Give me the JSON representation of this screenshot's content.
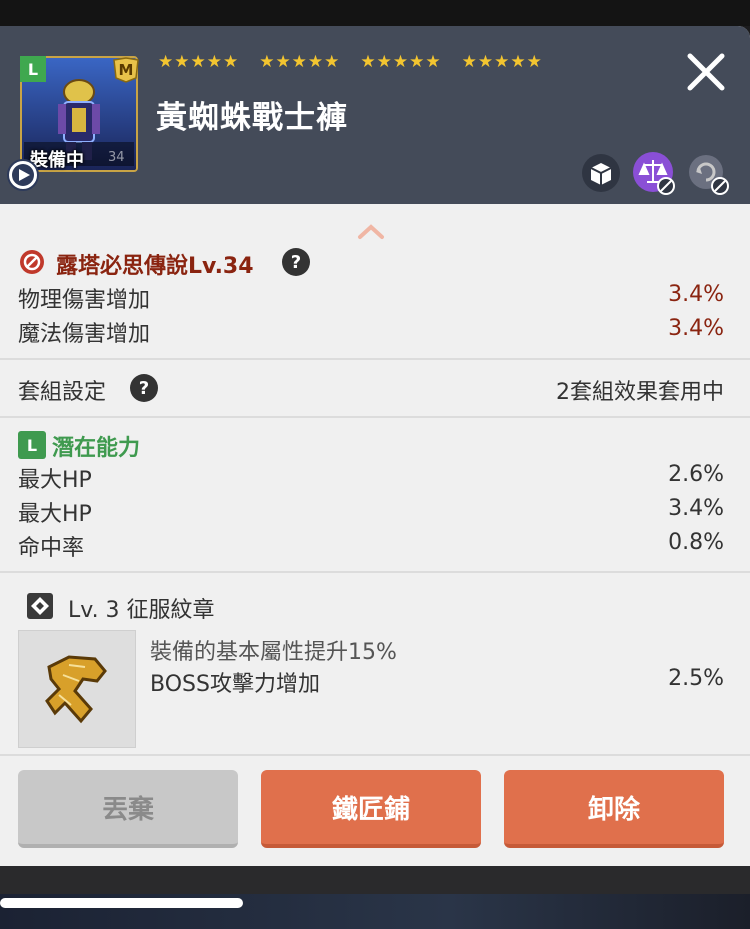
{
  "header": {
    "item_name": "黃蜘蛛戰士褲",
    "equipped_label": "裝備中",
    "item_level_small": "34",
    "grade_badge": "L",
    "rank_badge": "M",
    "stars": [
      "★★★★★",
      "★★★★★",
      "★★★★★",
      "★★★★★"
    ],
    "icons": [
      "lock-box-icon",
      "balance-disabled-icon",
      "refresh-disabled-icon",
      "close-icon",
      "play-icon"
    ]
  },
  "set_section": {
    "title": "露塔必思傳說Lv.34",
    "help": "?",
    "stats": [
      {
        "label": "物理傷害增加",
        "value": "3.4%"
      },
      {
        "label": "魔法傷害增加",
        "value": "3.4%"
      }
    ]
  },
  "set_config": {
    "label": "套組設定",
    "help": "?",
    "status": "2套組效果套用中"
  },
  "potential": {
    "badge": "L",
    "title": "潛在能力",
    "stats": [
      {
        "label": "最大HP",
        "value": "2.6%"
      },
      {
        "label": "最大HP",
        "value": "3.4%"
      },
      {
        "label": "命中率",
        "value": "0.8%"
      }
    ]
  },
  "emblem": {
    "title": "Lv. 3 征服紋章",
    "line1": "裝備的基本屬性提升15%",
    "line2_label": "BOSS攻擊力增加",
    "line2_value": "2.5%"
  },
  "buttons": {
    "discard": "丟棄",
    "smith": "鐵匠鋪",
    "unequip": "卸除"
  },
  "colors": {
    "header_bg": "#444b59",
    "accent_orange": "#e0704c",
    "value_red": "#8a2410",
    "potential_green": "#3f9a4f",
    "star_gold": "#f3c530"
  }
}
